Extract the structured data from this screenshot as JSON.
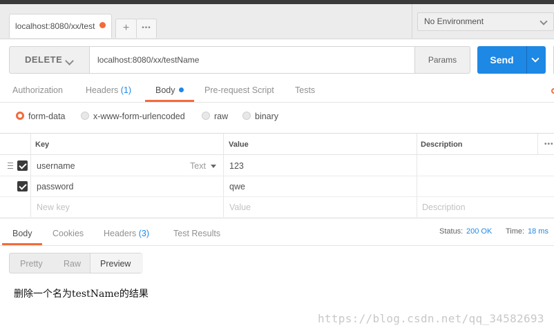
{
  "request_tab": {
    "label": "localhost:8080/xx/test"
  },
  "tabstrip": {
    "new_tab": "+",
    "more": "•••"
  },
  "environment": {
    "selected": "No Environment"
  },
  "request": {
    "method": "DELETE",
    "url": "localhost:8080/xx/testName",
    "params_label": "Params",
    "send_label": "Send"
  },
  "request_tabs": [
    {
      "label": "Authorization"
    },
    {
      "label": "Headers",
      "count": "(1)"
    },
    {
      "label": "Body"
    },
    {
      "label": "Pre-request Script"
    },
    {
      "label": "Tests"
    }
  ],
  "body_modes": [
    {
      "label": "form-data",
      "selected": true
    },
    {
      "label": "x-www-form-urlencoded"
    },
    {
      "label": "raw"
    },
    {
      "label": "binary"
    }
  ],
  "table": {
    "headers": {
      "key": "Key",
      "value": "Value",
      "description": "Description",
      "more": "•••"
    },
    "rows": [
      {
        "key": "username",
        "type": "Text",
        "value": "123"
      },
      {
        "key": "password",
        "value": "qwe"
      }
    ],
    "placeholders": {
      "key": "New key",
      "value": "Value",
      "description": "Description"
    }
  },
  "response_tabs": [
    {
      "label": "Body"
    },
    {
      "label": "Cookies"
    },
    {
      "label": "Headers",
      "count": "(3)"
    },
    {
      "label": "Test Results"
    }
  ],
  "status": {
    "status_label": "Status:",
    "status_value": "200 OK",
    "time_label": "Time:",
    "time_value": "18 ms"
  },
  "view_modes": [
    "Pretty",
    "Raw",
    "Preview"
  ],
  "response_body": "删除一个名为testName的结果",
  "watermark": "https://blog.csdn.net/qq_34582693",
  "colors": {
    "accent": "#f26b3a",
    "primary": "#1e88e5"
  }
}
